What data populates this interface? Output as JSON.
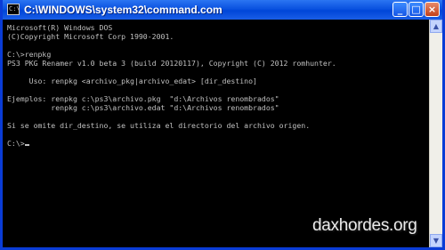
{
  "window": {
    "title": "C:\\WINDOWS\\system32\\command.com",
    "icon_label": "C:\\",
    "buttons": {
      "minimize": "_",
      "maximize": "□",
      "close": "×"
    }
  },
  "console": {
    "lines": [
      "Microsoft(R) Windows DOS",
      "(C)Copyright Microsoft Corp 1990-2001.",
      "",
      "C:\\>renpkg",
      "PS3 PKG Renamer v1.0 beta 3 (build 20120117), Copyright (C) 2012 romhunter.",
      "",
      "     Uso: renpkg <archivo_pkg|archivo_edat> [dir_destino]",
      "",
      "Ejemplos: renpkg c:\\ps3\\archivo.pkg  \"d:\\Archivos renombrados\"",
      "          renpkg c:\\ps3\\archivo.edat \"d:\\Archivos renombrados\"",
      "",
      "Si se omite dir_destino, se utiliza el directorio del archivo origen.",
      ""
    ],
    "prompt": "C:\\>"
  },
  "scrollbar": {
    "up_icon": "up-arrow-icon",
    "down_icon": "down-arrow-icon"
  },
  "watermark": {
    "text": "daxhordes.org"
  },
  "colors": {
    "titlebar": "#0a52e0",
    "console_bg": "#000000",
    "console_fg": "#c0c0c0"
  }
}
